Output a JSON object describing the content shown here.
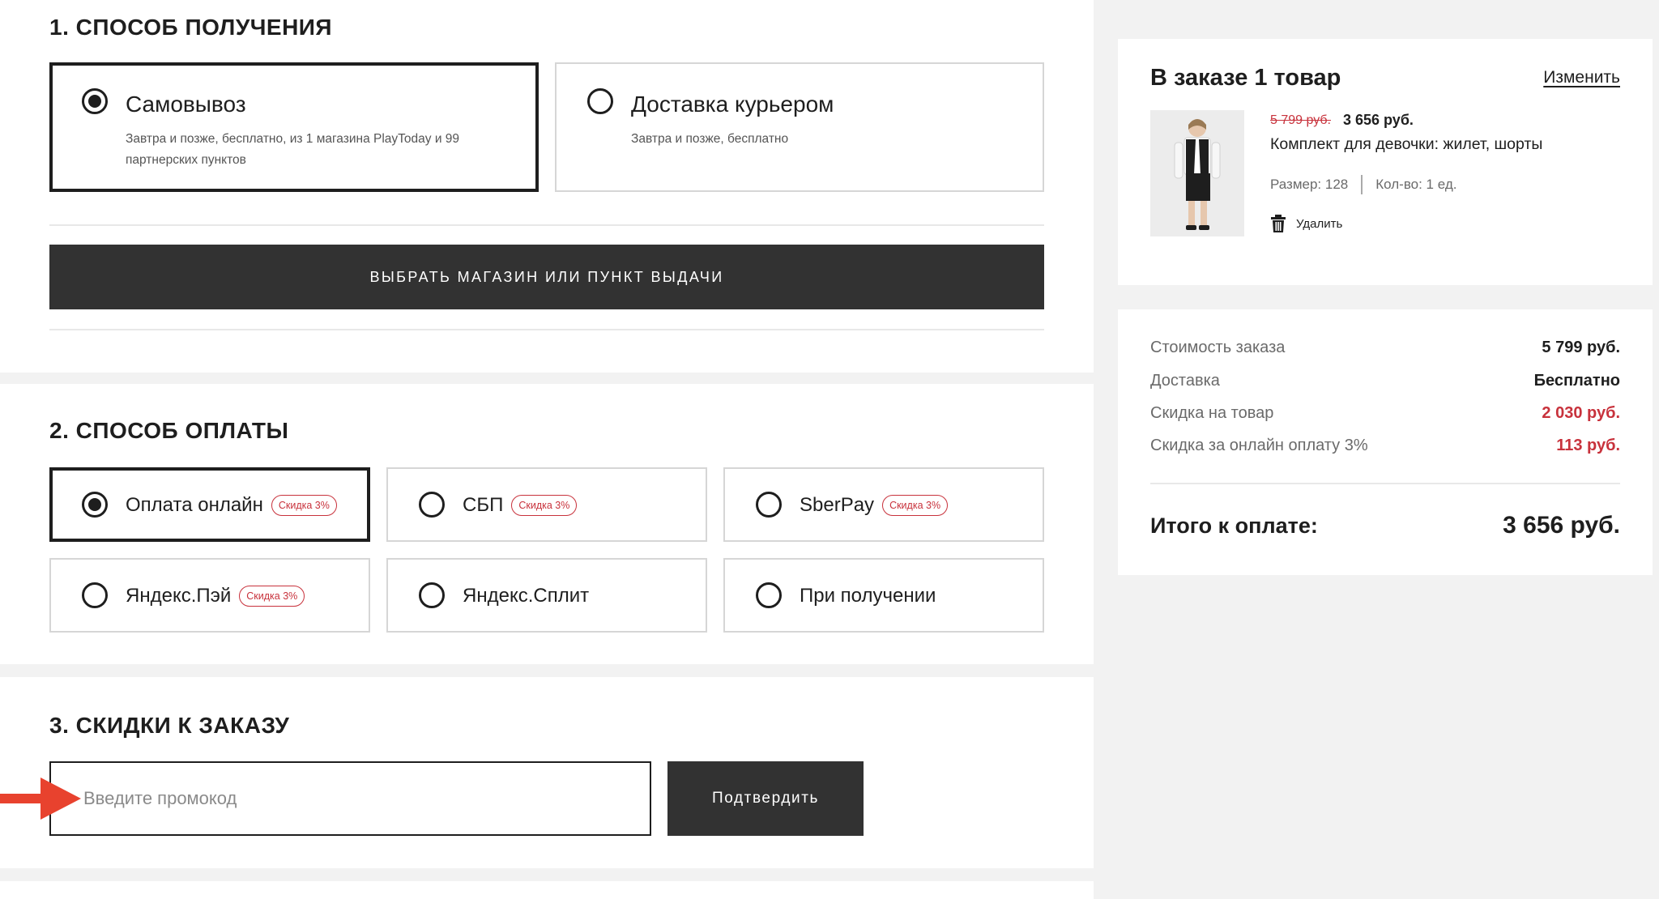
{
  "sections": {
    "delivery_title": "1. СПОСОБ ПОЛУЧЕНИЯ",
    "payment_title": "2. СПОСОБ ОПЛАТЫ",
    "discounts_title": "3. СКИДКИ К ЗАКАЗУ"
  },
  "delivery": {
    "options": [
      {
        "title": "Самовывоз",
        "desc": "Завтра и позже, бесплатно, из 1 магазина PlayToday и 99 партнерских пунктов",
        "selected": true
      },
      {
        "title": "Доставка курьером",
        "desc": "Завтра и позже, бесплатно",
        "selected": false
      }
    ],
    "choose_button": "ВЫБРАТЬ МАГАЗИН ИЛИ ПУНКТ ВЫДАЧИ"
  },
  "payment": {
    "options": [
      {
        "label": "Оплата онлайн",
        "badge": "Скидка 3%",
        "selected": true
      },
      {
        "label": "СБП",
        "badge": "Скидка 3%",
        "selected": false
      },
      {
        "label": "SberPay",
        "badge": "Скидка 3%",
        "selected": false
      },
      {
        "label": "Яндекс.Пэй",
        "badge": "Скидка 3%",
        "selected": false
      },
      {
        "label": "Яндекс.Сплит",
        "badge": "",
        "selected": false
      },
      {
        "label": "При получении",
        "badge": "",
        "selected": false
      }
    ]
  },
  "promo": {
    "placeholder": "Введите промокод",
    "confirm_button": "Подтвердить"
  },
  "order": {
    "title": "В заказе 1 товар",
    "change_link": "Изменить",
    "item": {
      "old_price": "5 799 руб.",
      "price": "3 656 руб.",
      "name": "Комплект для девочки: жилет, шорты",
      "size": "Размер: 128",
      "qty": "Кол-во: 1 ед.",
      "delete": "Удалить"
    }
  },
  "totals": {
    "rows": [
      {
        "label": "Стоимость заказа",
        "value": "5 799 руб."
      },
      {
        "label": "Доставка",
        "value": "Бесплатно"
      },
      {
        "label": "Скидка на товар",
        "value": "2 030 руб."
      },
      {
        "label": "Скидка за онлайн оплату 3%",
        "value": "113 руб."
      }
    ],
    "grand_label": "Итого к оплате:",
    "grand_value": "3 656 руб."
  },
  "colors": {
    "accent_red": "#c8323c",
    "dark_button": "#323232",
    "arrow": "#e8422e"
  }
}
